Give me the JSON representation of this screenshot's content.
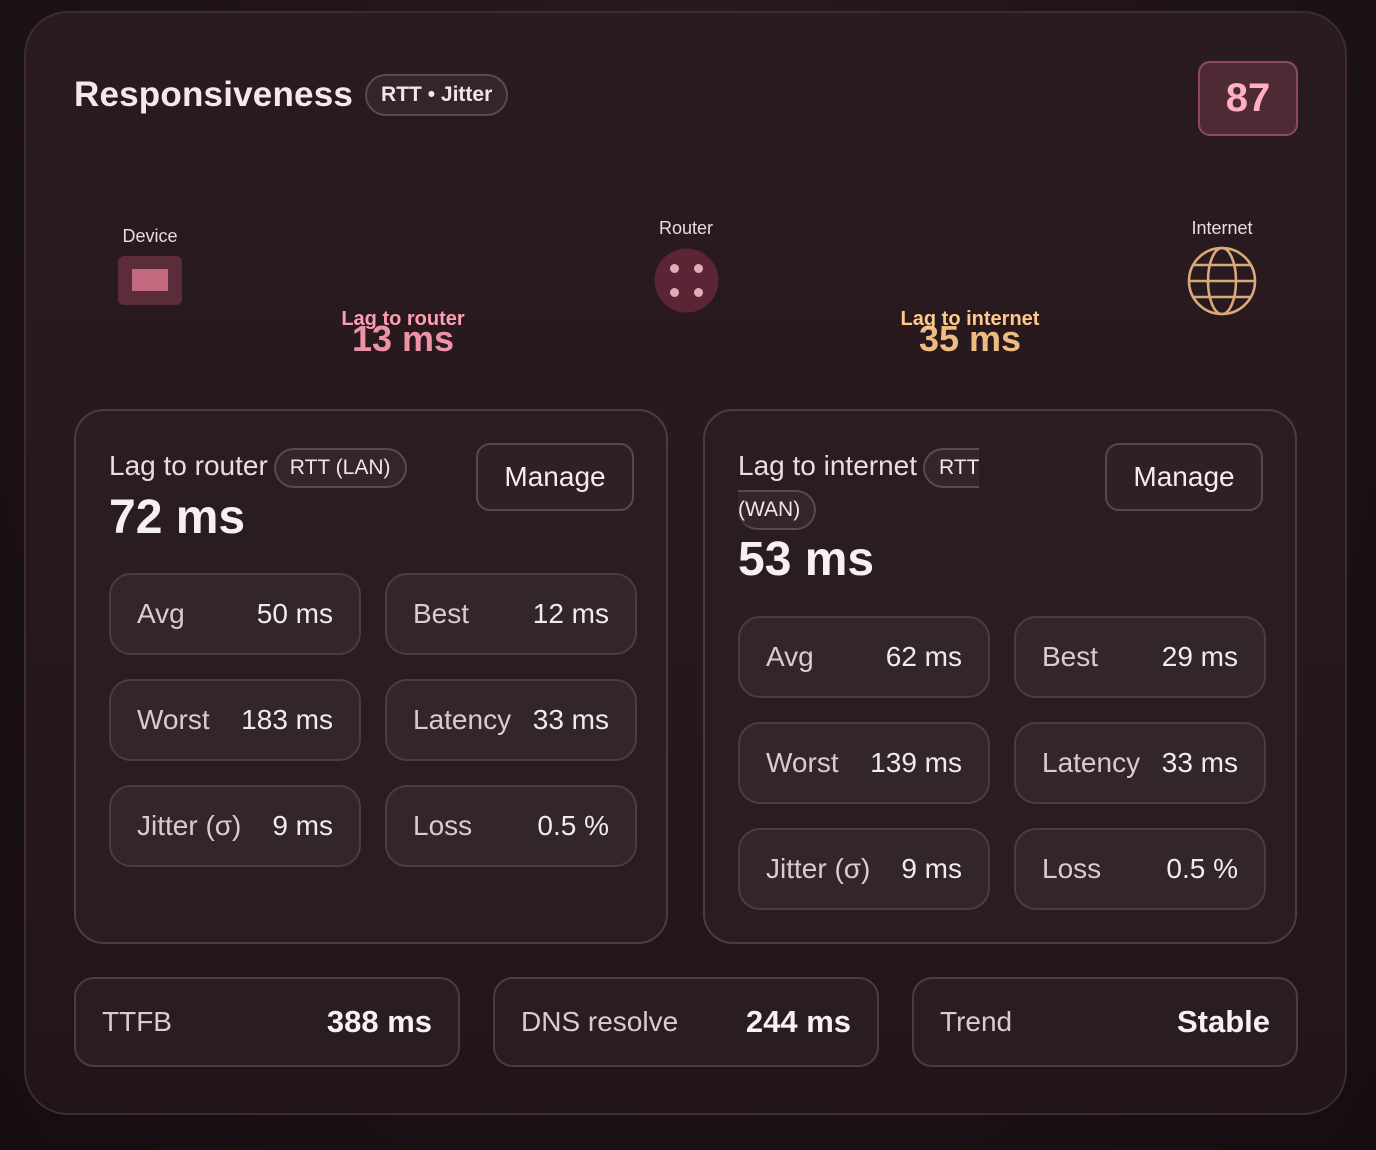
{
  "header": {
    "title": "Responsiveness",
    "badge": "RTT • Jitter",
    "score": "87"
  },
  "topology": {
    "nodes": {
      "device": "Device",
      "router": "Router",
      "internet": "Internet"
    },
    "links": {
      "router": {
        "label": "Lag to router",
        "value": "13 ms",
        "color": "#ff9db3"
      },
      "internet": {
        "label": "Lag to internet",
        "value": "35 ms",
        "color": "#ffc98a"
      }
    }
  },
  "panels": {
    "router": {
      "title": "Lag to router",
      "badge": "RTT (LAN)",
      "value": "72 ms",
      "manage_label": "Manage",
      "stats": [
        {
          "label": "Avg",
          "value": "50 ms"
        },
        {
          "label": "Best",
          "value": "12 ms"
        },
        {
          "label": "Worst",
          "value": "183 ms"
        },
        {
          "label": "Latency",
          "value": "33 ms"
        },
        {
          "label": "Jitter (σ)",
          "value": "9 ms"
        },
        {
          "label": "Loss",
          "value": "0.5 %"
        }
      ]
    },
    "internet": {
      "title": "Lag to internet",
      "badge_line1": "RTT",
      "badge_line2": "(WAN)",
      "value": "53 ms",
      "manage_label": "Manage",
      "stats": [
        {
          "label": "Avg",
          "value": "62 ms"
        },
        {
          "label": "Best",
          "value": "29 ms"
        },
        {
          "label": "Worst",
          "value": "139 ms"
        },
        {
          "label": "Latency",
          "value": "33 ms"
        },
        {
          "label": "Jitter (σ)",
          "value": "9 ms"
        },
        {
          "label": "Loss",
          "value": "0.5 %"
        }
      ]
    }
  },
  "summary": [
    {
      "label": "TTFB",
      "value": "388 ms"
    },
    {
      "label": "DNS resolve",
      "value": "244 ms"
    },
    {
      "label": "Trend",
      "value": "Stable"
    }
  ],
  "colors": {
    "accent": "#ff9db3",
    "warm": "#ffc98a",
    "score_bg": "#4e2a35"
  },
  "icons": [
    "device-icon",
    "router-icon",
    "globe-icon"
  ]
}
